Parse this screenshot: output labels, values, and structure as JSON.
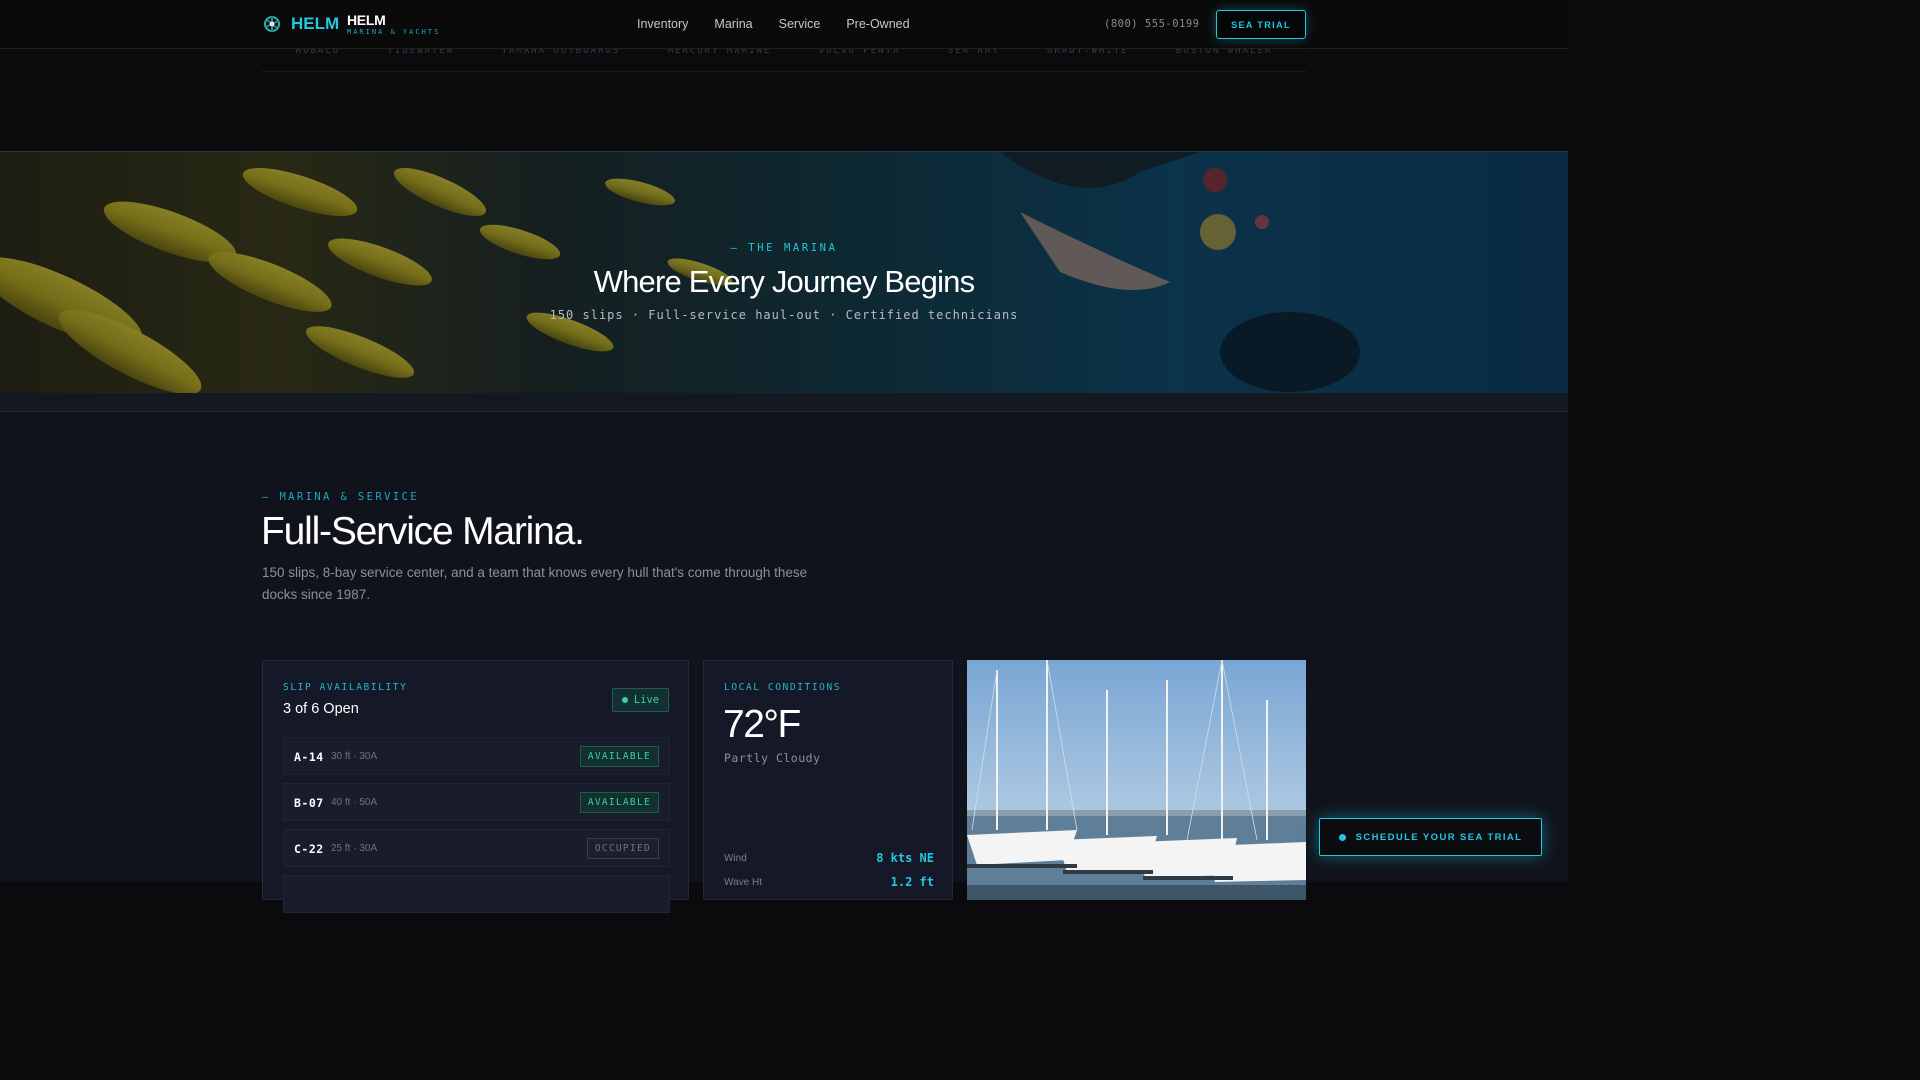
{
  "nav": {
    "logo_text": "HELM",
    "brand_name": "HELM",
    "brand_tagline": "MARINA & YACHTS",
    "links": [
      "Inventory",
      "Marina",
      "Service",
      "Pre-Owned"
    ],
    "phone": "(800) 555-0199",
    "cta_label": "SEA TRIAL"
  },
  "brands": [
    "ROBALO",
    "TIDEWATER",
    "YAMAHA OUTBOARDS",
    "MERCURY MARINE",
    "VOLVO PENTA",
    "SEA RAY",
    "GRADY-WHITE",
    "BOSTON WHALER"
  ],
  "hero": {
    "eyebrow": "— THE MARINA",
    "title": "Where Every Journey Begins",
    "subtitle": "150 slips · Full-service haul-out · Certified technicians"
  },
  "section": {
    "eyebrow": "— MARINA & SERVICE",
    "title": "Full-Service Marina.",
    "description": "150 slips, 8-bay service center, and a team that knows every hull that's come through these docks since 1987."
  },
  "slips": {
    "label": "SLIP AVAILABILITY",
    "count": "3 of 6 Open",
    "live_label": "Live",
    "rows": [
      {
        "id": "A-14",
        "spec": "30 ft · 30A",
        "status": "AVAILABLE"
      },
      {
        "id": "B-07",
        "spec": "40 ft · 50A",
        "status": "AVAILABLE"
      },
      {
        "id": "C-22",
        "spec": "25 ft · 30A",
        "status": "OCCUPIED"
      }
    ]
  },
  "conditions": {
    "label": "LOCAL CONDITIONS",
    "temperature": "72°F",
    "summary": "Partly Cloudy",
    "rows": [
      {
        "key": "Wind",
        "value": "8 kts NE"
      },
      {
        "key": "Wave Ht",
        "value": "1.2 ft"
      }
    ]
  },
  "float_cta": "SCHEDULE YOUR SEA TRIAL",
  "colors": {
    "accent": "#22c7e0",
    "available": "#38d0b0"
  }
}
